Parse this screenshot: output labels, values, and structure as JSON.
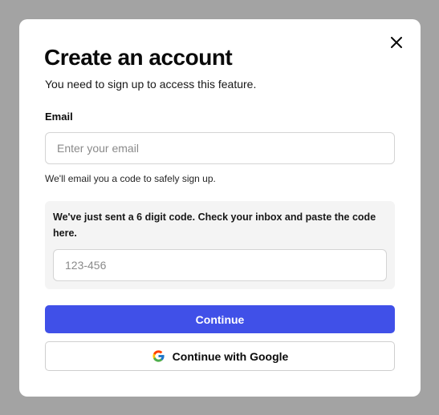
{
  "modal": {
    "title": "Create an account",
    "subtitle": "You need to sign up to access this feature.",
    "close_icon": "close-icon"
  },
  "email": {
    "label": "Email",
    "placeholder": "Enter your email",
    "value": "",
    "hint": "We'll email you a code to safely sign up."
  },
  "code": {
    "message": "We've just sent a 6 digit code. Check your inbox and paste the code here.",
    "placeholder": "123-456",
    "value": ""
  },
  "actions": {
    "continue_label": "Continue",
    "google_label": "Continue with Google",
    "google_icon": "google-icon"
  },
  "colors": {
    "overlay": "#a3a3a3",
    "primary": "#4050e8",
    "panel": "#f4f4f4"
  }
}
